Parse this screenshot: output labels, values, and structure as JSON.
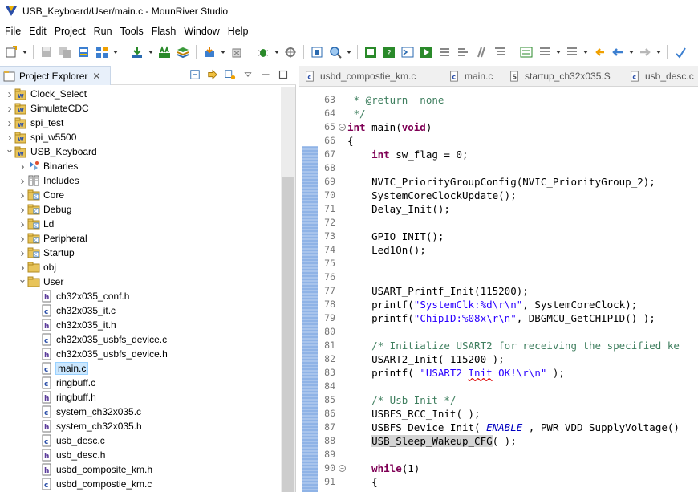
{
  "window": {
    "title": "USB_Keyboard/User/main.c - MounRiver Studio"
  },
  "menubar": {
    "items": [
      "File",
      "Edit",
      "Project",
      "Run",
      "Tools",
      "Flash",
      "Window",
      "Help"
    ]
  },
  "project_explorer": {
    "tab_label": "Project Explorer",
    "tree": [
      {
        "label": "Clock_Select",
        "depth": 0,
        "expand": "collapsed",
        "icon": "project-icon"
      },
      {
        "label": "SimulateCDC",
        "depth": 0,
        "expand": "collapsed",
        "icon": "project-icon"
      },
      {
        "label": "spi_test",
        "depth": 0,
        "expand": "collapsed",
        "icon": "project-icon"
      },
      {
        "label": "spi_w5500",
        "depth": 0,
        "expand": "collapsed",
        "icon": "project-icon"
      },
      {
        "label": "USB_Keyboard",
        "depth": 0,
        "expand": "expanded",
        "icon": "project-icon"
      },
      {
        "label": "Binaries",
        "depth": 1,
        "expand": "collapsed",
        "icon": "binaries-icon"
      },
      {
        "label": "Includes",
        "depth": 1,
        "expand": "collapsed",
        "icon": "includes-icon"
      },
      {
        "label": "Core",
        "depth": 1,
        "expand": "collapsed",
        "icon": "source-folder-icon"
      },
      {
        "label": "Debug",
        "depth": 1,
        "expand": "collapsed",
        "icon": "source-folder-icon"
      },
      {
        "label": "Ld",
        "depth": 1,
        "expand": "collapsed",
        "icon": "source-folder-icon"
      },
      {
        "label": "Peripheral",
        "depth": 1,
        "expand": "collapsed",
        "icon": "source-folder-icon"
      },
      {
        "label": "Startup",
        "depth": 1,
        "expand": "collapsed",
        "icon": "source-folder-icon"
      },
      {
        "label": "obj",
        "depth": 1,
        "expand": "collapsed",
        "icon": "folder-icon"
      },
      {
        "label": "User",
        "depth": 1,
        "expand": "expanded",
        "icon": "folder-icon"
      },
      {
        "label": "ch32x035_conf.h",
        "depth": 2,
        "expand": "none",
        "icon": "h-file-icon"
      },
      {
        "label": "ch32x035_it.c",
        "depth": 2,
        "expand": "none",
        "icon": "c-file-icon"
      },
      {
        "label": "ch32x035_it.h",
        "depth": 2,
        "expand": "none",
        "icon": "h-file-icon"
      },
      {
        "label": "ch32x035_usbfs_device.c",
        "depth": 2,
        "expand": "none",
        "icon": "c-file-icon"
      },
      {
        "label": "ch32x035_usbfs_device.h",
        "depth": 2,
        "expand": "none",
        "icon": "h-file-icon"
      },
      {
        "label": "main.c",
        "depth": 2,
        "expand": "none",
        "icon": "c-file-icon",
        "selected": true
      },
      {
        "label": "ringbuff.c",
        "depth": 2,
        "expand": "none",
        "icon": "c-file-icon"
      },
      {
        "label": "ringbuff.h",
        "depth": 2,
        "expand": "none",
        "icon": "h-file-icon"
      },
      {
        "label": "system_ch32x035.c",
        "depth": 2,
        "expand": "none",
        "icon": "c-file-icon"
      },
      {
        "label": "system_ch32x035.h",
        "depth": 2,
        "expand": "none",
        "icon": "h-file-icon"
      },
      {
        "label": "usb_desc.c",
        "depth": 2,
        "expand": "none",
        "icon": "c-file-icon"
      },
      {
        "label": "usb_desc.h",
        "depth": 2,
        "expand": "none",
        "icon": "h-file-icon"
      },
      {
        "label": "usbd_composite_km.h",
        "depth": 2,
        "expand": "none",
        "icon": "h-file-icon"
      },
      {
        "label": "usbd_compostie_km.c",
        "depth": 2,
        "expand": "none",
        "icon": "c-file-icon"
      }
    ]
  },
  "editor": {
    "tabs": [
      {
        "label": "usbd_compostie_km.c",
        "icon": "c-file-icon"
      },
      {
        "label": "main.c",
        "icon": "c-file-icon"
      },
      {
        "label": "startup_ch32x035.S",
        "icon": "s-file-icon"
      },
      {
        "label": "usb_desc.c",
        "icon": "c-file-icon"
      }
    ],
    "lines": [
      {
        "n": "63",
        "fold": false,
        "text": " * @return  none"
      },
      {
        "n": "64",
        "fold": false,
        "text": " */"
      },
      {
        "n": "65",
        "fold": true,
        "text": "int main(void)"
      },
      {
        "n": "66",
        "fold": false,
        "text": "{"
      },
      {
        "n": "67",
        "fold": false,
        "text": "    int sw_flag = 0;"
      },
      {
        "n": "68",
        "fold": false,
        "text": ""
      },
      {
        "n": "69",
        "fold": false,
        "text": "    NVIC_PriorityGroupConfig(NVIC_PriorityGroup_2);"
      },
      {
        "n": "70",
        "fold": false,
        "text": "    SystemCoreClockUpdate();"
      },
      {
        "n": "71",
        "fold": false,
        "text": "    Delay_Init();"
      },
      {
        "n": "72",
        "fold": false,
        "text": ""
      },
      {
        "n": "73",
        "fold": false,
        "text": "    GPIO_INIT();"
      },
      {
        "n": "74",
        "fold": false,
        "text": "    Led1On();"
      },
      {
        "n": "75",
        "fold": false,
        "text": ""
      },
      {
        "n": "76",
        "fold": false,
        "text": ""
      },
      {
        "n": "77",
        "fold": false,
        "text": "    USART_Printf_Init(115200);"
      },
      {
        "n": "78",
        "fold": false,
        "text": "    printf(\"SystemClk:%d\\r\\n\", SystemCoreClock);"
      },
      {
        "n": "79",
        "fold": false,
        "text": "    printf(\"ChipID:%08x\\r\\n\", DBGMCU_GetCHIPID() );"
      },
      {
        "n": "80",
        "fold": false,
        "text": ""
      },
      {
        "n": "81",
        "fold": false,
        "text": "    /* Initialize USART2 for receiving the specified ke"
      },
      {
        "n": "82",
        "fold": false,
        "text": "    USART2_Init( 115200 );"
      },
      {
        "n": "83",
        "fold": false,
        "text": "    printf( \"USART2 Init OK!\\r\\n\" );"
      },
      {
        "n": "84",
        "fold": false,
        "text": ""
      },
      {
        "n": "85",
        "fold": false,
        "text": "    /* Usb Init */"
      },
      {
        "n": "86",
        "fold": false,
        "text": "    USBFS_RCC_Init( );"
      },
      {
        "n": "87",
        "fold": false,
        "text": "    USBFS_Device_Init( ENABLE , PWR_VDD_SupplyVoltage()"
      },
      {
        "n": "88",
        "fold": false,
        "text": "    USB_Sleep_Wakeup_CFG( );"
      },
      {
        "n": "89",
        "fold": false,
        "text": ""
      },
      {
        "n": "90",
        "fold": true,
        "text": "    while(1)"
      },
      {
        "n": "91",
        "fold": false,
        "text": "    {"
      }
    ]
  }
}
